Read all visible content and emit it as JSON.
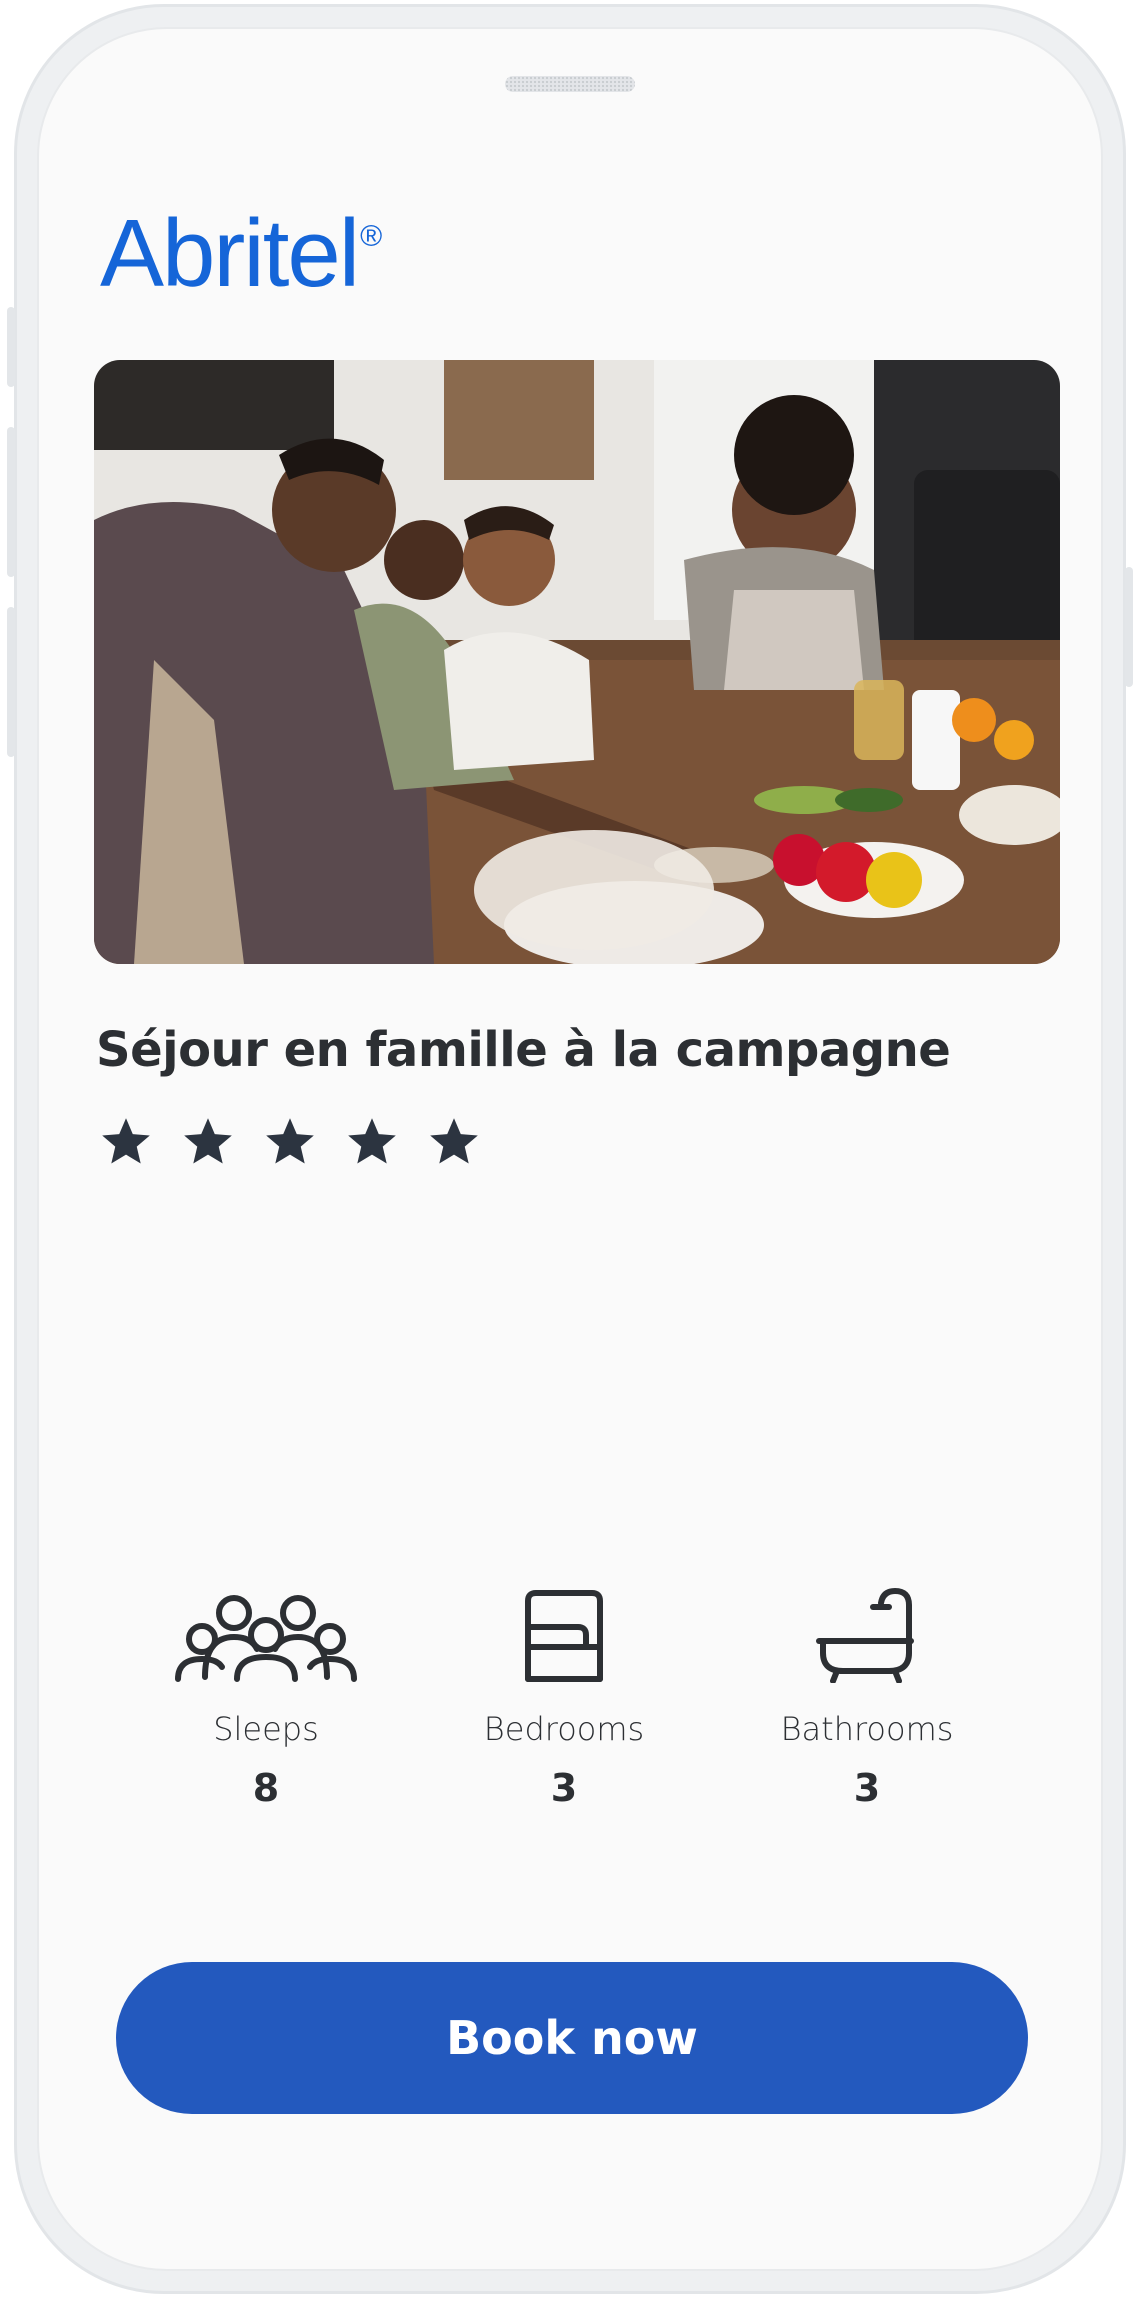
{
  "brand": {
    "logo_text": "Abritel",
    "logo_mark": "®",
    "color": "#1565d8"
  },
  "listing": {
    "photo": "family-cooking-kitchen-photo",
    "title": "Séjour en famille à la campagne",
    "rating": 5,
    "rating_max": 5
  },
  "amenities": [
    {
      "icon": "people-icon",
      "label": "Sleeps",
      "value": "8"
    },
    {
      "icon": "bed-icon",
      "label": "Bedrooms",
      "value": "3"
    },
    {
      "icon": "bathtub-icon",
      "label": "Bathrooms",
      "value": "3"
    }
  ],
  "cta": {
    "label": "Book now",
    "color": "#2359be"
  }
}
